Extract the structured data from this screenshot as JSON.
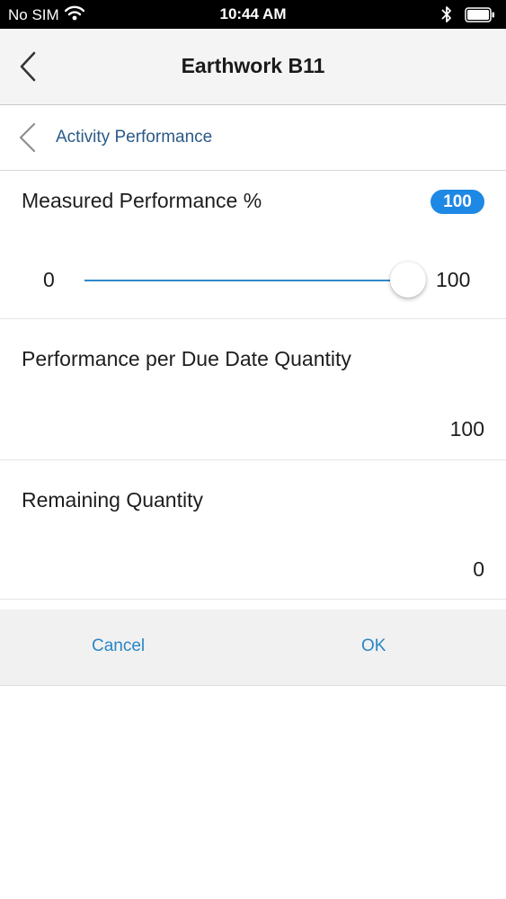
{
  "status_bar": {
    "carrier": "No SIM",
    "time": "10:44 AM",
    "icons": [
      "wifi-icon",
      "bluetooth-icon",
      "battery-icon"
    ]
  },
  "nav_bar": {
    "title": "Earthwork B11",
    "back_icon": "chevron-left-icon"
  },
  "sub_nav": {
    "title": "Activity Performance",
    "back_icon": "chevron-left-icon"
  },
  "measured_performance": {
    "label": "Measured Performance %",
    "badge_value": "100",
    "slider": {
      "min_label": "0",
      "max_label": "100",
      "value": 100
    }
  },
  "performance_due": {
    "label": "Performance per Due Date Quantity",
    "value": "100"
  },
  "remaining": {
    "label": "Remaining Quantity",
    "value": "0"
  },
  "actions": {
    "cancel_label": "Cancel",
    "ok_label": "OK"
  },
  "colors": {
    "accent": "#1e88e5",
    "link": "#2a86c6",
    "sub_nav_text": "#2a5a88"
  }
}
